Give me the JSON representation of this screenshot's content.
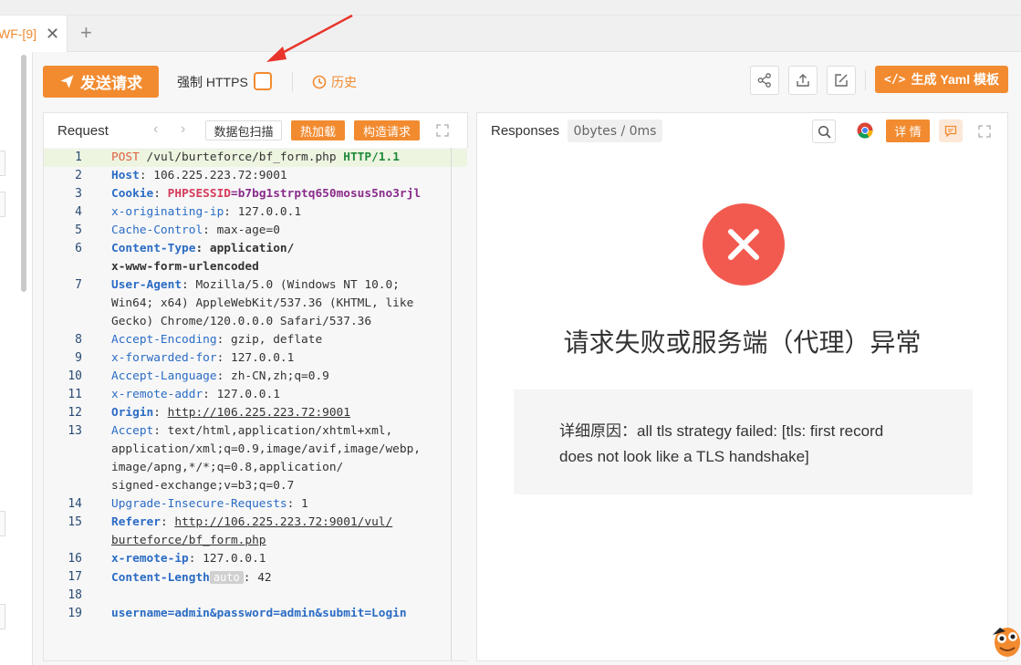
{
  "tabs": [
    {
      "label": "WF-[9]"
    }
  ],
  "toolbar": {
    "send_label": "发送请求",
    "https_label": "强制 HTTPS",
    "history_label": "历史",
    "yaml_label": "生成 Yaml 模板"
  },
  "request": {
    "title": "Request",
    "scan_label": "数据包扫描",
    "hotload_label": "热加载",
    "construct_label": "构造请求",
    "line_numbers": [
      "1",
      "2",
      "3",
      "4",
      "5",
      "6",
      "7",
      "8",
      "9",
      "10",
      "11",
      "12",
      "13",
      "14",
      "15",
      "16",
      "17",
      "18",
      "19"
    ],
    "lines": {
      "l1_method": "POST",
      "l1_path": " /vul/burteforce/bf_form.php ",
      "l1_version": "HTTP/1.1",
      "l2_key": "Host",
      "l2_val": ": 106.225.223.72:9001",
      "l3_key": "Cookie",
      "l3_sep": ": ",
      "l3_ck": "PHPSESSID",
      "l3_cv": "=b7bg1strptq650mosus5no3rjl",
      "l4_key": "x-originating-ip",
      "l4_val": ": 127.0.0.1",
      "l5_key": "Cache-Control",
      "l5_val": ": max-age=0",
      "l6_key": "Content-Type",
      "l6_val": ": application/",
      "l6_cont": "x-www-form-urlencoded",
      "l7_key": "User-Agent",
      "l7_val": ": Mozilla/5.0 (Windows NT 10.0;",
      "l7_cont1": "Win64; x64) AppleWebKit/537.36 (KHTML, like",
      "l7_cont2": "Gecko) Chrome/120.0.0.0 Safari/537.36",
      "l8_key": "Accept-Encoding",
      "l8_val": ": gzip, deflate",
      "l9_key": "x-forwarded-for",
      "l9_val": ": 127.0.0.1",
      "l10_key": "Accept-Language",
      "l10_val": ": zh-CN,zh;q=0.9",
      "l11_key": "x-remote-addr",
      "l11_val": ": 127.0.0.1",
      "l12_key": "Origin",
      "l12_sep": ": ",
      "l12_url": "http://106.225.223.72:9001",
      "l13_key": "Accept",
      "l13_val": ": text/html,application/xhtml+xml,",
      "l13_cont1": "application/xml;q=0.9,image/avif,image/webp,",
      "l13_cont2": "image/apng,*/*;q=0.8,application/",
      "l13_cont3": "signed-exchange;v=b3;q=0.7",
      "l14_key": "Upgrade-Insecure-Requests",
      "l14_val": ": 1",
      "l15_key": "Referer",
      "l15_sep": ": ",
      "l15_url": "http://106.225.223.72:9001/vul/",
      "l15_cont": "burteforce/bf_form.php",
      "l16_key": "x-remote-ip",
      "l16_val": ": 127.0.0.1",
      "l17_key": "Content-Length",
      "l17_badge": "auto",
      "l17_val": ": 42",
      "l19_body": "username=admin&password=admin&submit=Login"
    }
  },
  "response": {
    "title": "Responses",
    "bytes_label": "0bytes / 0ms",
    "detail_label": "详 情",
    "error_title": "请求失败或服务端（代理）异常",
    "error_detail_line1": "详细原因：all tls strategy failed: [tls: first record",
    "error_detail_line2": "does not look like a TLS handshake]"
  },
  "colors": {
    "accent": "#f28b30",
    "error": "#f25a50"
  }
}
